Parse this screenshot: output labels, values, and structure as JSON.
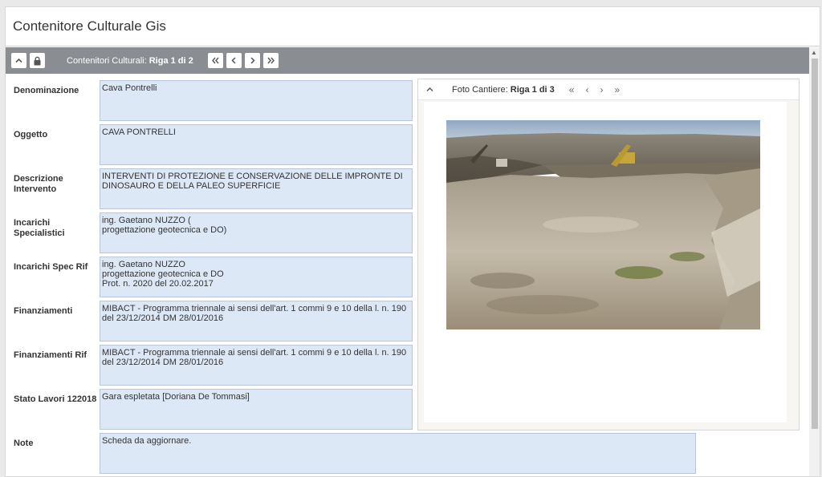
{
  "title": "Contenitore Culturale Gis",
  "toolbar": {
    "label": "Contenitori Culturali:",
    "record": "Riga 1 di 2",
    "buttons": [
      "collapse-up",
      "lock",
      "first",
      "prev",
      "next",
      "last"
    ]
  },
  "fields": [
    {
      "label": "Denominazione",
      "value": "Cava Pontrelli"
    },
    {
      "label": "Oggetto",
      "value": "CAVA PONTRELLI"
    },
    {
      "label": "Descrizione Intervento",
      "value": "INTERVENTI DI PROTEZIONE E CONSERVAZIONE DELLE IMPRONTE DI DINOSAURO E DELLA PALEO SUPERFICIE"
    },
    {
      "label": "Incarichi Specialistici",
      "value": "ing. Gaetano NUZZO (\nprogettazione geotecnica e DO)"
    },
    {
      "label": "Incarichi Spec Rif",
      "value": "ing. Gaetano NUZZO\nprogettazione geotecnica e DO\nProt. n. 2020 del 20.02.2017"
    },
    {
      "label": "Finanziamenti",
      "value": "MIBACT - Programma triennale ai sensi dell'art. 1 commi 9 e 10 della l. n. 190 del 23/12/2014 DM 28/01/2016"
    },
    {
      "label": "Finanziamenti Rif",
      "value": "MIBACT - Programma triennale ai sensi dell'art. 1 commi 9 e 10 della l. n. 190 del 23/12/2014 DM 28/01/2016"
    },
    {
      "label": "Stato Lavori 122018",
      "value": "Gara espletata [Doriana De Tommasi]"
    },
    {
      "label": "Note",
      "value": "Scheda da aggiornare."
    }
  ],
  "photo": {
    "label": "Foto Cantiere:",
    "record": "Riga 1 di 3",
    "nav": [
      "«",
      "‹",
      "›",
      "»"
    ]
  },
  "colors": {
    "toolbar": "#8a8d91",
    "field_bg": "#dde8f6",
    "field_border": "#b9c7d8"
  }
}
